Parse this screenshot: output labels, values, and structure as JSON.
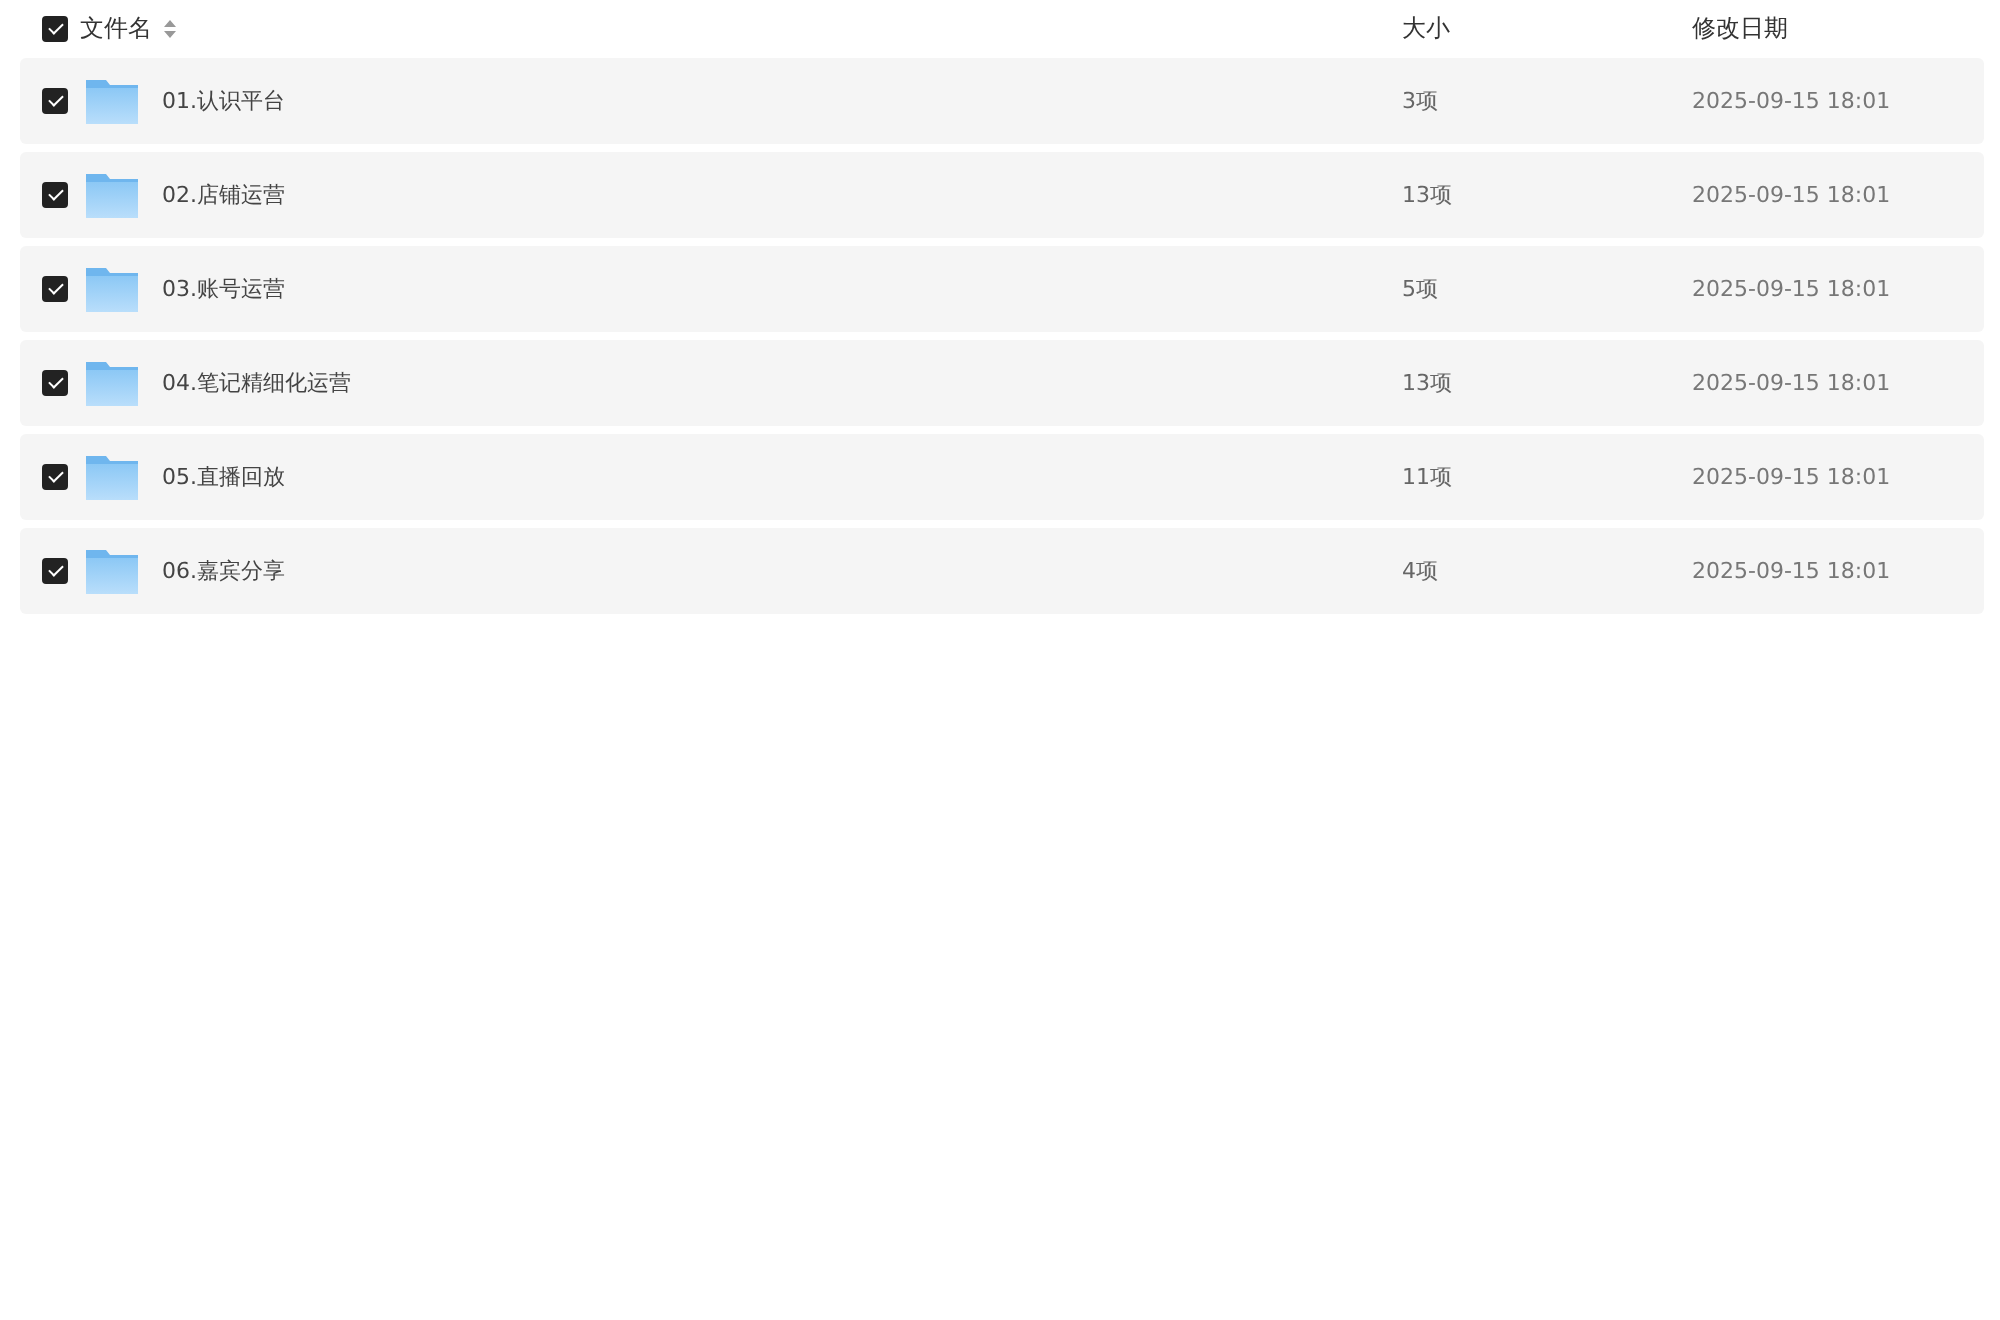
{
  "header": {
    "checked": true,
    "columns": [
      "文件名",
      "大小",
      "修改日期"
    ]
  },
  "rows": [
    {
      "checked": true,
      "name": "01.认识平台",
      "size": "3项",
      "modified": "2025-09-15 18:01"
    },
    {
      "checked": true,
      "name": "02.店铺运营",
      "size": "13项",
      "modified": "2025-09-15 18:01"
    },
    {
      "checked": true,
      "name": "03.账号运营",
      "size": "5项",
      "modified": "2025-09-15 18:01"
    },
    {
      "checked": true,
      "name": "04.笔记精细化运营",
      "size": "13项",
      "modified": "2025-09-15 18:01"
    },
    {
      "checked": true,
      "name": "05.直播回放",
      "size": "11项",
      "modified": "2025-09-15 18:01"
    },
    {
      "checked": true,
      "name": "06.嘉宾分享",
      "size": "4项",
      "modified": "2025-09-15 18:01"
    }
  ]
}
